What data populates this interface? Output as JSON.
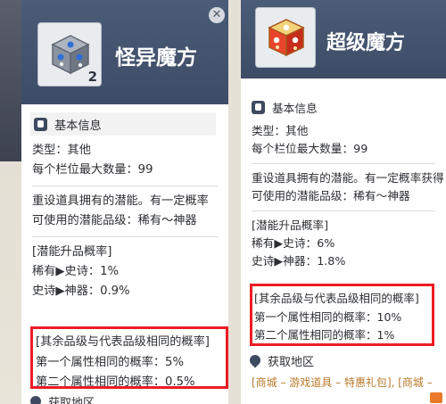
{
  "left_card": {
    "title": "怪异魔方",
    "quantity": "2",
    "close_label": "✕",
    "icon": "gray-cube-icon",
    "section_basic": "基本信息",
    "type_line": "类型：其他",
    "stack_line": "每个栏位最大数量：99",
    "desc_line1": "重设道具拥有的潜能。有一定概率",
    "desc_line2": "可使用的潜能品级：稀有～神器",
    "upgrade_header": "[潜能升品概率]",
    "upgrade_1": "稀有▶史诗：1%",
    "upgrade_2": "史诗▶神器：0.9%",
    "hl_header": "[其余品级与代表品级相同的概率]",
    "hl_line1": "第一个属性相同的概率：5%",
    "hl_line2": "第二个属性相同的概率：0.5%",
    "obtain_partial": "获取地区"
  },
  "right_card": {
    "title": "超级魔方",
    "icon": "red-cube-icon",
    "section_basic": "基本信息",
    "type_line": "类型：其他",
    "stack_line": "每个栏位最大数量：99",
    "desc_line1": "重设道具拥有的潜能。有一定概率获得",
    "desc_line2": "可使用的潜能品级：稀有～神器",
    "upgrade_header": "[潜能升品概率]",
    "upgrade_1": "稀有▶史诗：6%",
    "upgrade_2": "史诗▶神器：1.8%",
    "hl_header": "[其余品级与代表品级相同的概率]",
    "hl_line1": "第一个属性相同的概率：10%",
    "hl_line2": "第二个属性相同的概率：1%",
    "obtain_header": "获取地区",
    "obtain_link": "[商城 – 游戏道具 – 特惠礼包], [商城 –"
  },
  "colors": {
    "header_bg": "#3d4c66",
    "highlight_border": "#ec1c24",
    "link_color": "#b8792a"
  }
}
